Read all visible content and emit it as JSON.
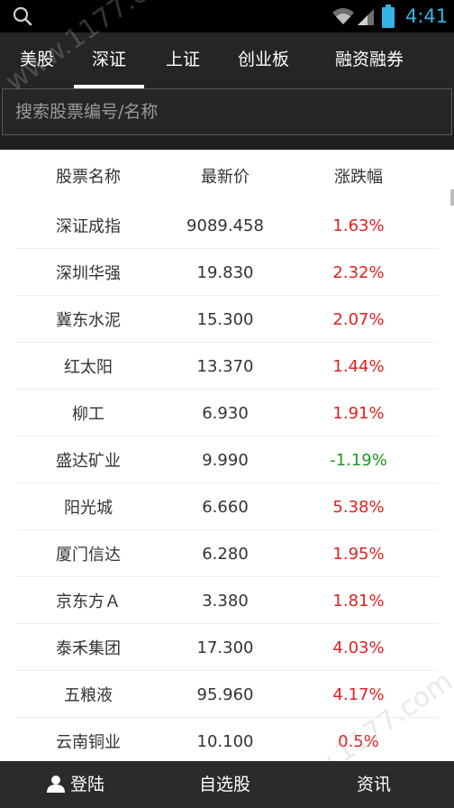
{
  "status_bar": {
    "time": "4:41",
    "icons": [
      "search-icon",
      "wifi-icon",
      "signal-icon",
      "battery-icon"
    ],
    "clock_color": "#33b5e5"
  },
  "tabs": [
    {
      "label": "美股",
      "active": false
    },
    {
      "label": "深证",
      "active": true
    },
    {
      "label": "上证",
      "active": false
    },
    {
      "label": "创业板",
      "active": false
    },
    {
      "label": "融资融券",
      "active": false
    }
  ],
  "search": {
    "placeholder": "搜索股票编号/名称"
  },
  "table": {
    "headers": {
      "name": "股票名称",
      "price": "最新价",
      "change": "涨跌幅"
    },
    "rows": [
      {
        "name": "深证成指",
        "price": "9089.458",
        "change": "1.63%",
        "direction": "up"
      },
      {
        "name": "深圳华强",
        "price": "19.830",
        "change": "2.32%",
        "direction": "up"
      },
      {
        "name": "冀东水泥",
        "price": "15.300",
        "change": "2.07%",
        "direction": "up"
      },
      {
        "name": "红太阳",
        "price": "13.370",
        "change": "1.44%",
        "direction": "up"
      },
      {
        "name": "柳工",
        "price": "6.930",
        "change": "1.91%",
        "direction": "up"
      },
      {
        "name": "盛达矿业",
        "price": "9.990",
        "change": "-1.19%",
        "direction": "down"
      },
      {
        "name": "阳光城",
        "price": "6.660",
        "change": "5.38%",
        "direction": "up"
      },
      {
        "name": "厦门信达",
        "price": "6.280",
        "change": "1.95%",
        "direction": "up"
      },
      {
        "name": "京东方Ａ",
        "price": "3.380",
        "change": "1.81%",
        "direction": "up"
      },
      {
        "name": "泰禾集团",
        "price": "17.300",
        "change": "4.03%",
        "direction": "up"
      },
      {
        "name": "五粮液",
        "price": "95.960",
        "change": "4.17%",
        "direction": "up"
      },
      {
        "name": "云南铜业",
        "price": "10.100",
        "change": "0.5%",
        "direction": "up"
      }
    ]
  },
  "bottom_nav": {
    "login": {
      "label": "登陆",
      "icon": "user-icon"
    },
    "watchlist": {
      "label": "自选股"
    },
    "news": {
      "label": "资讯"
    }
  },
  "watermark": "www.1177.com",
  "colors": {
    "up": "#e02020",
    "down": "#1a9a1a",
    "tabbar": "#252525",
    "bottombar": "#2b2b2b"
  }
}
